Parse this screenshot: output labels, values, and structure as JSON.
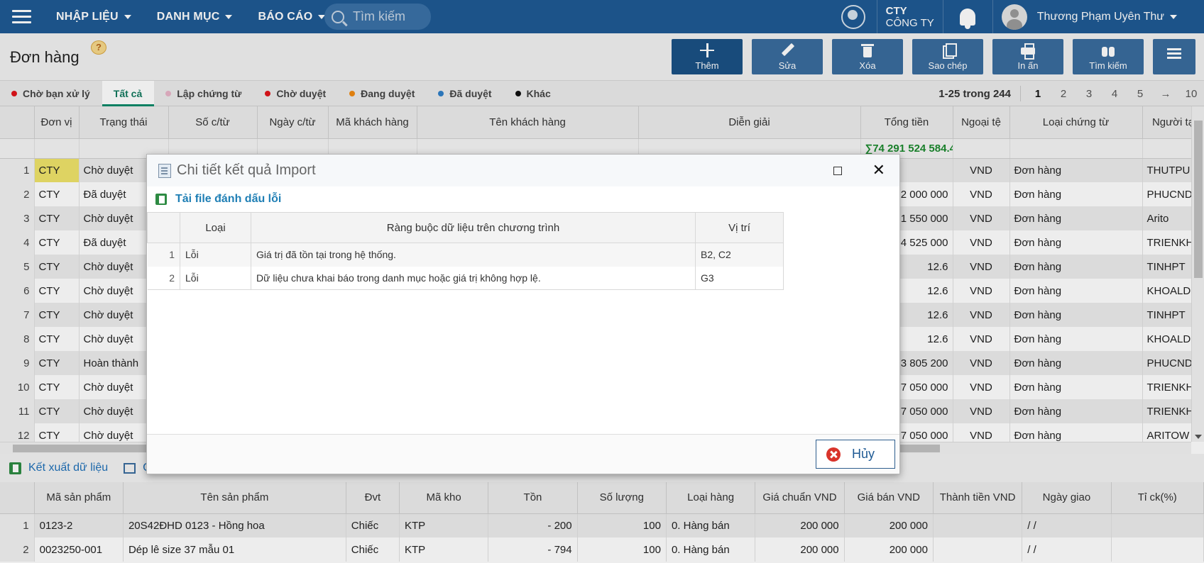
{
  "topbar": {
    "menu": [
      {
        "label": "NHẬP LIỆU"
      },
      {
        "label": "DANH MỤC"
      },
      {
        "label": "BÁO CÁO"
      }
    ],
    "search_placeholder": "Tìm kiếm",
    "company_short": "CTY",
    "company_name": "CÔNG TY",
    "user_name": "Thương Phạm Uyên Thư"
  },
  "header": {
    "title": "Đơn hàng",
    "help": "?",
    "toolbar": {
      "add": "Thêm",
      "edit": "Sửa",
      "delete": "Xóa",
      "copy": "Sao chép",
      "print": "In ấn",
      "search": "Tìm kiếm"
    }
  },
  "tabs": [
    {
      "label": "Chờ bạn xử lý",
      "color": "#e0151b"
    },
    {
      "label": "Tất cả",
      "active": true
    },
    {
      "label": "Lập chứng từ",
      "color": "#e8b4c8"
    },
    {
      "label": "Chờ duyệt",
      "color": "#e0151b"
    },
    {
      "label": "Đang duyệt",
      "color": "#f08a12"
    },
    {
      "label": "Đã duyệt",
      "color": "#2f7fc8"
    },
    {
      "label": "Khác",
      "color": "#111111"
    }
  ],
  "pager": {
    "range": "1-25 trong",
    "total": "244",
    "pages": [
      "1",
      "2",
      "3",
      "4",
      "5",
      "→",
      "10"
    ],
    "current": "1"
  },
  "grid": {
    "columns": [
      "Đơn vị",
      "Trạng thái",
      "Số c/từ",
      "Ngày c/từ",
      "Mã khách hàng",
      "Tên khách hàng",
      "Diễn giải",
      "Tổng tiền",
      "Ngoại tệ",
      "Loại chứng từ",
      "Người tạ"
    ],
    "sum_total": "∑74 291 524 584.4",
    "rows": [
      {
        "n": "1",
        "unit": "CTY",
        "status": "Chờ duyệt",
        "total": "",
        "cur": "VND",
        "type": "Đơn hàng",
        "user": "THUTPU"
      },
      {
        "n": "2",
        "unit": "CTY",
        "status": "Đã duyệt",
        "total": "2 000 000",
        "cur": "VND",
        "type": "Đơn hàng",
        "user": "PHUCND"
      },
      {
        "n": "3",
        "unit": "CTY",
        "status": "Chờ duyệt",
        "total": "1 550 000",
        "cur": "VND",
        "type": "Đơn hàng",
        "user": "Arito"
      },
      {
        "n": "4",
        "unit": "CTY",
        "status": "Đã duyệt",
        "total": "4 525 000",
        "cur": "VND",
        "type": "Đơn hàng",
        "user": "TRIENKHA"
      },
      {
        "n": "5",
        "unit": "CTY",
        "status": "Chờ duyệt",
        "total": "12.6",
        "cur": "VND",
        "type": "Đơn hàng",
        "user": "TINHPT"
      },
      {
        "n": "6",
        "unit": "CTY",
        "status": "Chờ duyệt",
        "total": "12.6",
        "cur": "VND",
        "type": "Đơn hàng",
        "user": "KHOALD"
      },
      {
        "n": "7",
        "unit": "CTY",
        "status": "Chờ duyệt",
        "total": "12.6",
        "cur": "VND",
        "type": "Đơn hàng",
        "user": "TINHPT"
      },
      {
        "n": "8",
        "unit": "CTY",
        "status": "Chờ duyệt",
        "total": "12.6",
        "cur": "VND",
        "type": "Đơn hàng",
        "user": "KHOALD"
      },
      {
        "n": "9",
        "unit": "CTY",
        "status": "Hoàn thành",
        "total": "3 805 200",
        "cur": "VND",
        "type": "Đơn hàng",
        "user": "PHUCND"
      },
      {
        "n": "10",
        "unit": "CTY",
        "status": "Chờ duyệt",
        "total": "7 050 000",
        "cur": "VND",
        "type": "Đơn hàng",
        "user": "TRIENKHA"
      },
      {
        "n": "11",
        "unit": "CTY",
        "status": "Chờ duyệt",
        "total": "7 050 000",
        "cur": "VND",
        "type": "Đơn hàng",
        "user": "TRIENKHA"
      },
      {
        "n": "12",
        "unit": "CTY",
        "status": "Chờ duyệt",
        "total": "7 050 000",
        "cur": "VND",
        "type": "Đơn hàng",
        "user": "ARITOW"
      }
    ]
  },
  "bottom": {
    "export_label": "Kết xuất dữ liệu",
    "print_label": "C"
  },
  "detail": {
    "columns": [
      "Mã sản phẩm",
      "Tên sản phẩm",
      "Đvt",
      "Mã kho",
      "Tồn",
      "Số lượng",
      "Loại hàng",
      "Giá chuẩn VND",
      "Giá bán VND",
      "Thành tiền VND",
      "Ngày giao",
      "Tỉ ck(%)"
    ],
    "rows": [
      {
        "n": "1",
        "code": "0123-2",
        "name": "20S42ĐHD 0123 - Hồng hoa",
        "unit": "Chiếc",
        "wh": "KTP",
        "stock": "- 200",
        "qty": "100",
        "kind": "0. Hàng bán",
        "std": "200 000",
        "price": "200 000",
        "amount": "",
        "date": "/ /",
        "disc": ""
      },
      {
        "n": "2",
        "code": "0023250-001",
        "name": "Dép lê size 37 mẫu 01",
        "unit": "Chiếc",
        "wh": "KTP",
        "stock": "- 794",
        "qty": "100",
        "kind": "0. Hàng bán",
        "std": "200 000",
        "price": "200 000",
        "amount": "",
        "date": "/ /",
        "disc": ""
      }
    ]
  },
  "dialog": {
    "title": "Chi tiết kết quả Import",
    "download_link": "Tải file đánh dấu lỗi",
    "columns": [
      "Loại",
      "Ràng buộc dữ liệu trên chương trình",
      "Vị trí"
    ],
    "rows": [
      {
        "n": "1",
        "type": "Lỗi",
        "message": "Giá trị đã tồn tại trong hệ thống.",
        "position": "B2, C2"
      },
      {
        "n": "2",
        "type": "Lỗi",
        "message": "Dữ liệu chưa khai báo trong danh mục hoặc giá trị không hợp lệ.",
        "position": "G3"
      }
    ],
    "cancel_label": "Hủy"
  }
}
